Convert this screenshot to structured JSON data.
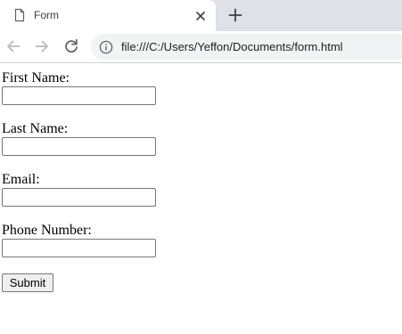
{
  "browser": {
    "tab": {
      "title": "Form",
      "icon": "document-icon",
      "close_icon": "close-icon"
    },
    "new_tab_icon": "plus-icon",
    "nav": {
      "back_icon": "arrow-left-icon",
      "forward_icon": "arrow-right-icon",
      "reload_icon": "reload-icon"
    },
    "address_bar": {
      "info_icon": "info-icon",
      "url": "file:///C:/Users/Yeffon/Documents/form.html"
    },
    "colors": {
      "tab_strip": "#dee1e6",
      "omnibox": "#f1f3f4"
    }
  },
  "form": {
    "fields": [
      {
        "label": "First Name:",
        "value": ""
      },
      {
        "label": "Last Name:",
        "value": ""
      },
      {
        "label": "Email:",
        "value": ""
      },
      {
        "label": "Phone Number:",
        "value": ""
      }
    ],
    "submit_label": "Submit"
  }
}
